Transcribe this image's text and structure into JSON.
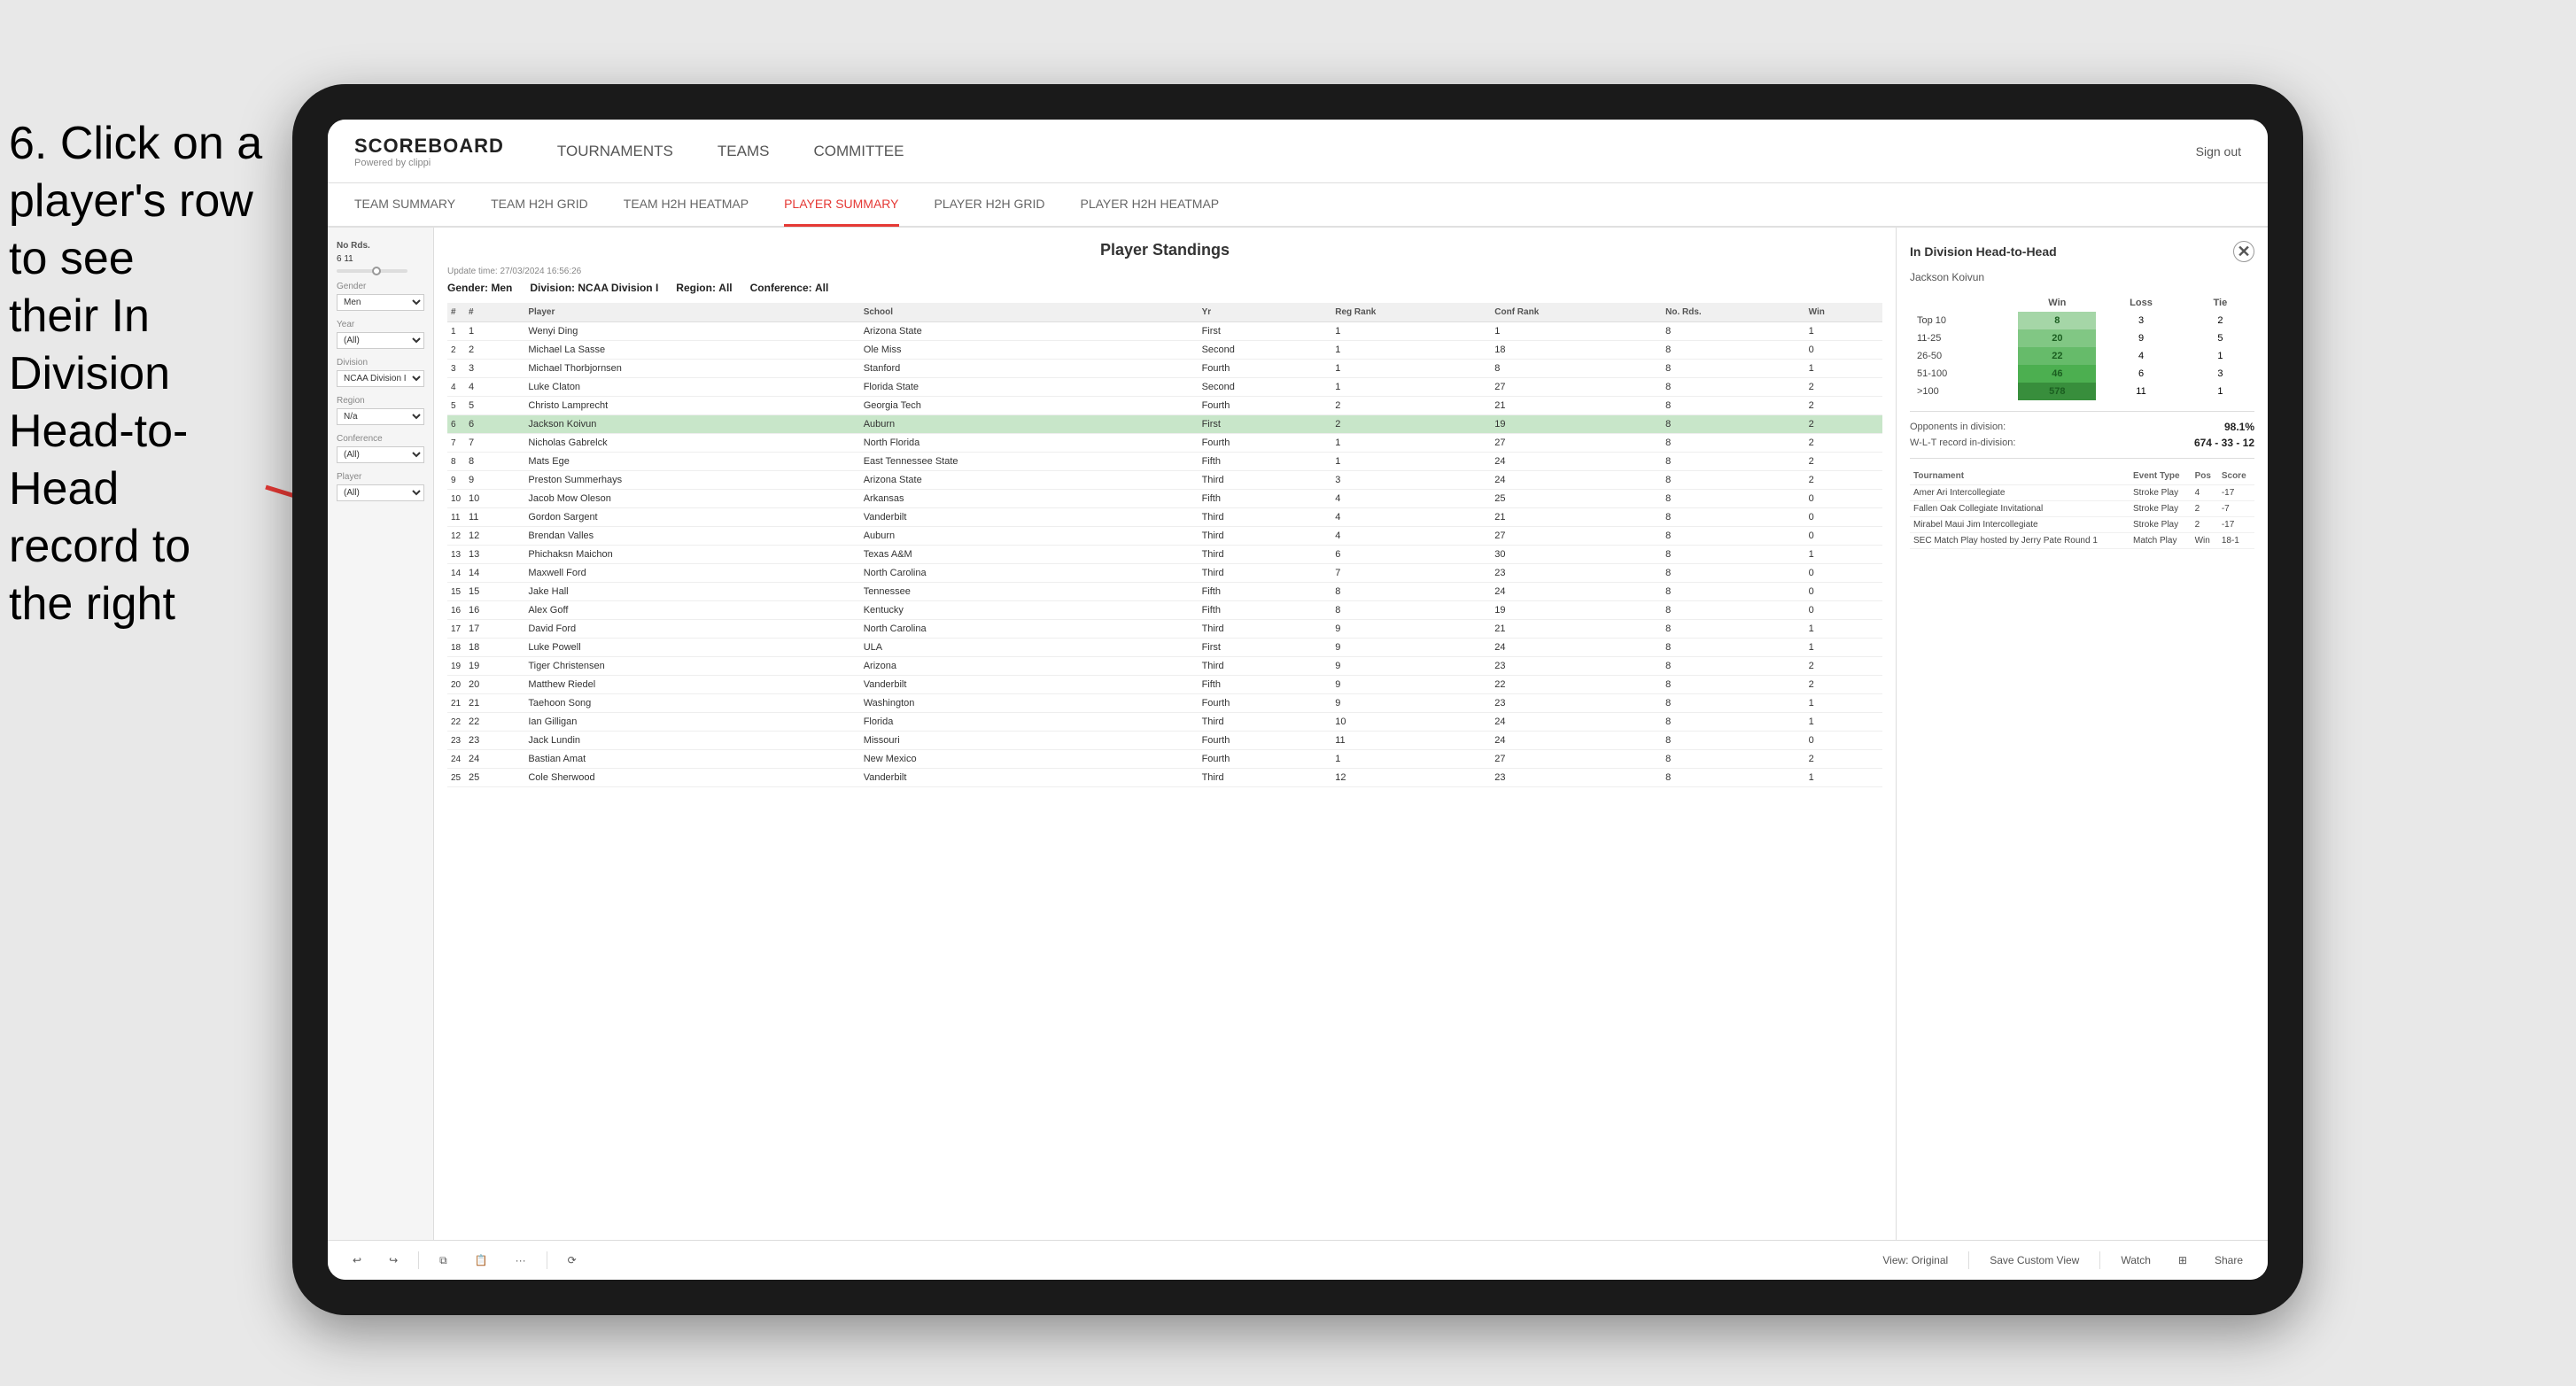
{
  "instruction": {
    "line1": "6. Click on a",
    "line2": "player's row to see",
    "line3": "their In Division",
    "line4": "Head-to-Head",
    "line5": "record to the right"
  },
  "app": {
    "logo_title": "SCOREBOARD",
    "logo_subtitle": "Powered by clippi",
    "nav_items": [
      "TOURNAMENTS",
      "TEAMS",
      "COMMITTEE"
    ],
    "sign_out": "Sign out",
    "sub_nav_items": [
      "TEAM SUMMARY",
      "TEAM H2H GRID",
      "TEAM H2H HEATMAP",
      "PLAYER SUMMARY",
      "PLAYER H2H GRID",
      "PLAYER H2H HEATMAP"
    ],
    "active_tab": "PLAYER SUMMARY"
  },
  "sidebar": {
    "no_rds_label": "No Rds.",
    "no_rds_value": "6",
    "no_rds_count": "11",
    "gender_label": "Gender",
    "gender_value": "Men",
    "year_label": "Year",
    "year_value": "(All)",
    "division_label": "Division",
    "division_value": "NCAA Division I",
    "region_label": "Region",
    "region_value": "N/a",
    "conference_label": "Conference",
    "conference_value": "(All)",
    "player_label": "Player",
    "player_value": "(All)"
  },
  "player_standings": {
    "title": "Player Standings",
    "update_time": "Update time:",
    "update_date": "27/03/2024 16:56:26",
    "gender_label": "Gender:",
    "gender_value": "Men",
    "division_label": "Division:",
    "division_value": "NCAA Division I",
    "region_label": "Region:",
    "region_value": "All",
    "conference_label": "Conference:",
    "conference_value": "All",
    "columns": [
      "#",
      "Player",
      "School",
      "Yr",
      "Reg Rank",
      "Conf Rank",
      "No. Rds.",
      "Win"
    ],
    "players": [
      {
        "id": 1,
        "num": "1",
        "player": "Wenyi Ding",
        "school": "Arizona State",
        "yr": "First",
        "reg_rank": "1",
        "conf_rank": "1",
        "no_rds": "8",
        "win": "1"
      },
      {
        "id": 2,
        "num": "2",
        "player": "Michael La Sasse",
        "school": "Ole Miss",
        "yr": "Second",
        "reg_rank": "1",
        "conf_rank": "18",
        "no_rds": "8",
        "win": "0"
      },
      {
        "id": 3,
        "num": "3",
        "player": "Michael Thorbjornsen",
        "school": "Stanford",
        "yr": "Fourth",
        "reg_rank": "1",
        "conf_rank": "8",
        "no_rds": "8",
        "win": "1"
      },
      {
        "id": 4,
        "num": "4",
        "player": "Luke Claton",
        "school": "Florida State",
        "yr": "Second",
        "reg_rank": "1",
        "conf_rank": "27",
        "no_rds": "8",
        "win": "2"
      },
      {
        "id": 5,
        "num": "5",
        "player": "Christo Lamprecht",
        "school": "Georgia Tech",
        "yr": "Fourth",
        "reg_rank": "2",
        "conf_rank": "21",
        "no_rds": "8",
        "win": "2"
      },
      {
        "id": 6,
        "num": "6",
        "player": "Jackson Koivun",
        "school": "Auburn",
        "yr": "First",
        "reg_rank": "2",
        "conf_rank": "19",
        "no_rds": "8",
        "win": "2",
        "selected": true
      },
      {
        "id": 7,
        "num": "7",
        "player": "Nicholas Gabrelck",
        "school": "North Florida",
        "yr": "Fourth",
        "reg_rank": "1",
        "conf_rank": "27",
        "no_rds": "8",
        "win": "2"
      },
      {
        "id": 8,
        "num": "8",
        "player": "Mats Ege",
        "school": "East Tennessee State",
        "yr": "Fifth",
        "reg_rank": "1",
        "conf_rank": "24",
        "no_rds": "8",
        "win": "2"
      },
      {
        "id": 9,
        "num": "9",
        "player": "Preston Summerhays",
        "school": "Arizona State",
        "yr": "Third",
        "reg_rank": "3",
        "conf_rank": "24",
        "no_rds": "8",
        "win": "2"
      },
      {
        "id": 10,
        "num": "10",
        "player": "Jacob Mow Oleson",
        "school": "Arkansas",
        "yr": "Fifth",
        "reg_rank": "4",
        "conf_rank": "25",
        "no_rds": "8",
        "win": "0"
      },
      {
        "id": 11,
        "num": "11",
        "player": "Gordon Sargent",
        "school": "Vanderbilt",
        "yr": "Third",
        "reg_rank": "4",
        "conf_rank": "21",
        "no_rds": "8",
        "win": "0"
      },
      {
        "id": 12,
        "num": "12",
        "player": "Brendan Valles",
        "school": "Auburn",
        "yr": "Third",
        "reg_rank": "4",
        "conf_rank": "27",
        "no_rds": "8",
        "win": "0"
      },
      {
        "id": 13,
        "num": "13",
        "player": "Phichaksn Maichon",
        "school": "Texas A&M",
        "yr": "Third",
        "reg_rank": "6",
        "conf_rank": "30",
        "no_rds": "8",
        "win": "1"
      },
      {
        "id": 14,
        "num": "14",
        "player": "Maxwell Ford",
        "school": "North Carolina",
        "yr": "Third",
        "reg_rank": "7",
        "conf_rank": "23",
        "no_rds": "8",
        "win": "0"
      },
      {
        "id": 15,
        "num": "15",
        "player": "Jake Hall",
        "school": "Tennessee",
        "yr": "Fifth",
        "reg_rank": "8",
        "conf_rank": "24",
        "no_rds": "8",
        "win": "0"
      },
      {
        "id": 16,
        "num": "16",
        "player": "Alex Goff",
        "school": "Kentucky",
        "yr": "Fifth",
        "reg_rank": "8",
        "conf_rank": "19",
        "no_rds": "8",
        "win": "0"
      },
      {
        "id": 17,
        "num": "17",
        "player": "David Ford",
        "school": "North Carolina",
        "yr": "Third",
        "reg_rank": "9",
        "conf_rank": "21",
        "no_rds": "8",
        "win": "1"
      },
      {
        "id": 18,
        "num": "18",
        "player": "Luke Powell",
        "school": "ULA",
        "yr": "First",
        "reg_rank": "9",
        "conf_rank": "24",
        "no_rds": "8",
        "win": "1"
      },
      {
        "id": 19,
        "num": "19",
        "player": "Tiger Christensen",
        "school": "Arizona",
        "yr": "Third",
        "reg_rank": "9",
        "conf_rank": "23",
        "no_rds": "8",
        "win": "2"
      },
      {
        "id": 20,
        "num": "20",
        "player": "Matthew Riedel",
        "school": "Vanderbilt",
        "yr": "Fifth",
        "reg_rank": "9",
        "conf_rank": "22",
        "no_rds": "8",
        "win": "2"
      },
      {
        "id": 21,
        "num": "21",
        "player": "Taehoon Song",
        "school": "Washington",
        "yr": "Fourth",
        "reg_rank": "9",
        "conf_rank": "23",
        "no_rds": "8",
        "win": "1"
      },
      {
        "id": 22,
        "num": "22",
        "player": "Ian Gilligan",
        "school": "Florida",
        "yr": "Third",
        "reg_rank": "10",
        "conf_rank": "24",
        "no_rds": "8",
        "win": "1"
      },
      {
        "id": 23,
        "num": "23",
        "player": "Jack Lundin",
        "school": "Missouri",
        "yr": "Fourth",
        "reg_rank": "11",
        "conf_rank": "24",
        "no_rds": "8",
        "win": "0"
      },
      {
        "id": 24,
        "num": "24",
        "player": "Bastian Amat",
        "school": "New Mexico",
        "yr": "Fourth",
        "reg_rank": "1",
        "conf_rank": "27",
        "no_rds": "8",
        "win": "2"
      },
      {
        "id": 25,
        "num": "25",
        "player": "Cole Sherwood",
        "school": "Vanderbilt",
        "yr": "Third",
        "reg_rank": "12",
        "conf_rank": "23",
        "no_rds": "8",
        "win": "1"
      }
    ]
  },
  "h2h": {
    "title": "In Division Head-to-Head",
    "player": "Jackson Koivun",
    "table_headers": [
      "",
      "Win",
      "Loss",
      "Tie"
    ],
    "rows": [
      {
        "label": "Top 10",
        "win": "8",
        "loss": "3",
        "tie": "2"
      },
      {
        "label": "11-25",
        "win": "20",
        "loss": "9",
        "tie": "5"
      },
      {
        "label": "26-50",
        "win": "22",
        "loss": "4",
        "tie": "1"
      },
      {
        "label": "51-100",
        "win": "46",
        "loss": "6",
        "tie": "3"
      },
      {
        "label": ">100",
        "win": "578",
        "loss": "11",
        "tie": "1"
      }
    ],
    "opponents_label": "Opponents in division:",
    "opponents_value": "98.1%",
    "wlt_label": "W-L-T record in-division:",
    "wlt_value": "674 - 33 - 12",
    "tournament_columns": [
      "Tournament",
      "Event Type",
      "Pos",
      "Score"
    ],
    "tournaments": [
      {
        "name": "Amer Ari Intercollegiate",
        "type": "Stroke Play",
        "pos": "4",
        "score": "-17"
      },
      {
        "name": "Fallen Oak Collegiate Invitational",
        "type": "Stroke Play",
        "pos": "2",
        "score": "-7"
      },
      {
        "name": "Mirabel Maui Jim Intercollegiate",
        "type": "Stroke Play",
        "pos": "2",
        "score": "-17"
      },
      {
        "name": "SEC Match Play hosted by Jerry Pate Round 1",
        "type": "Match Play",
        "pos": "Win",
        "score": "18-1"
      }
    ]
  },
  "toolbar": {
    "view_original": "View: Original",
    "save_custom": "Save Custom View",
    "watch": "Watch",
    "share": "Share"
  }
}
